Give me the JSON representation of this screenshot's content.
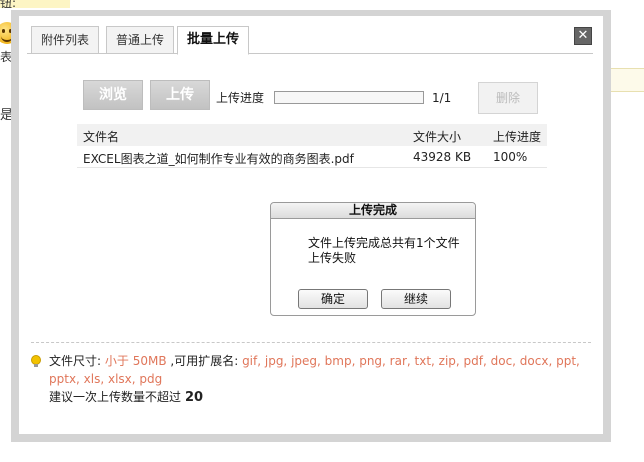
{
  "background": {
    "top_text": "钮:",
    "face_label": "表情",
    "side_text": "是"
  },
  "tabs": [
    {
      "label": "附件列表"
    },
    {
      "label": "普通上传"
    },
    {
      "label": "批量上传"
    }
  ],
  "close_label": "✕",
  "toolbar": {
    "browse_label": "浏览",
    "upload_label": "上传",
    "progress_label": "上传进度",
    "progress_count": "1/1",
    "progress_fraction": 1.0,
    "delete_label": "删除"
  },
  "file_table": {
    "headers": [
      "文件名",
      "文件大小",
      "上传进度"
    ],
    "rows": [
      {
        "name": "EXCEL图表之道_如何制作专业有效的商务图表.pdf",
        "size": "43928 KB",
        "progress": "100%"
      }
    ]
  },
  "msgbox": {
    "title": "上传完成",
    "text": "文件上传完成总共有1个文件上传失败",
    "ok_label": "确定",
    "continue_label": "继续"
  },
  "info": {
    "size_label": "文件尺寸:",
    "size_value": "小于 50MB",
    "ext_label": ",可用扩展名:",
    "extensions": "gif, jpg, jpeg, bmp, png, rar, txt, zip, pdf, doc, docx, ppt, pptx, xls, xlsx, pdg",
    "limit_label": "建议一次上传数量不超过",
    "limit_value": "20"
  },
  "colors": {
    "highlight": "#e0765a",
    "progress_fill": "#f7f7f7"
  }
}
